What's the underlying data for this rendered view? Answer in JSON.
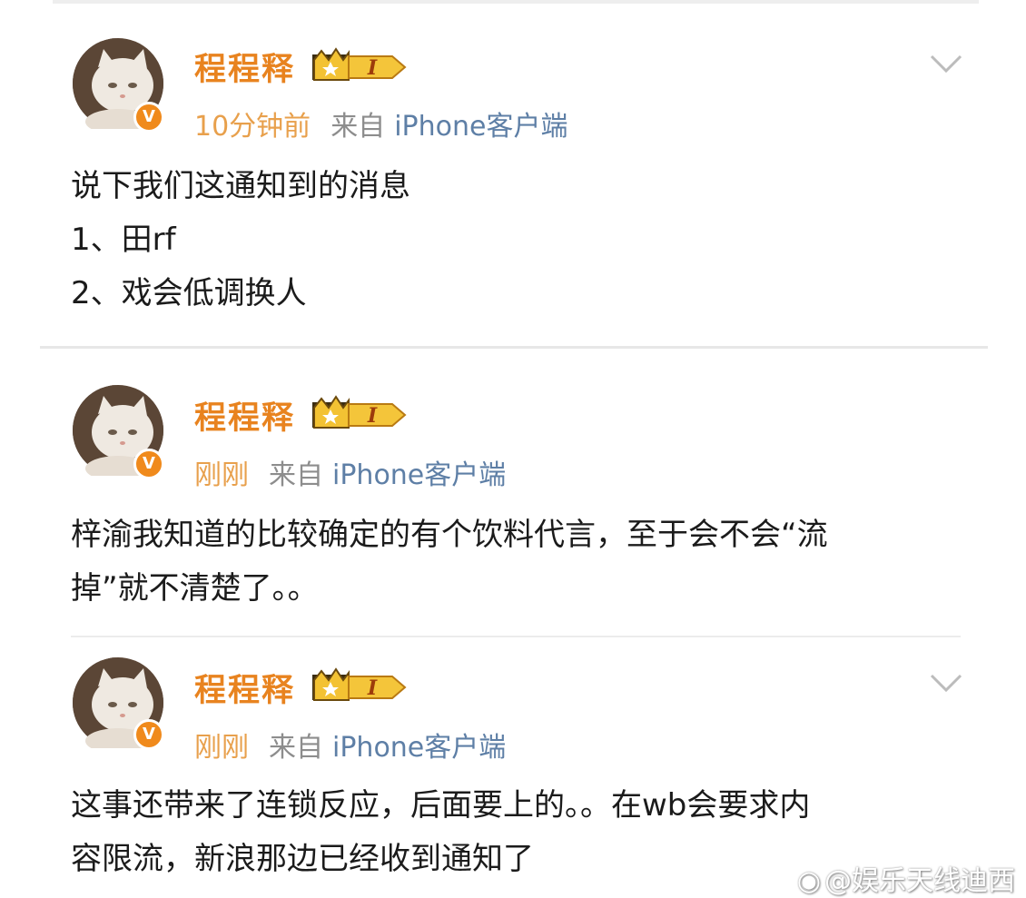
{
  "posts": [
    {
      "username": "程程释",
      "badge_level": "I",
      "time": "10分钟前",
      "source_prefix": "来自",
      "source_client": "iPhone客户端",
      "lines": [
        "说下我们这通知到的消息",
        "1、田rf",
        "2、戏会低调换人"
      ]
    },
    {
      "username": "程程释",
      "badge_level": "I",
      "time": "刚刚",
      "source_prefix": "来自",
      "source_client": "iPhone客户端",
      "lines": [
        "梓渝我知道的比较确定的有个饮料代言，至于会不会“流",
        "掉”就不清楚了。。"
      ]
    },
    {
      "username": "程程释",
      "badge_level": "I",
      "time": "刚刚",
      "source_prefix": "来自",
      "source_client": "iPhone客户端",
      "lines": [
        "这事还带来了连锁反应，后面要上的。。在wb会要求内",
        "容限流，新浪那边已经收到通知了"
      ]
    }
  ],
  "watermark": {
    "text": "@娱乐天线迪西"
  },
  "icons": {
    "avatar": "cat-avatar-icon",
    "verified": "verified-v-icon",
    "badge": "crown-level-badge-icon",
    "menu": "chevron-down-icon",
    "watermark": "weibo-logo-icon"
  },
  "colors": {
    "username": "#e8831f",
    "time": "#e8a04c",
    "source": "#8d8d8d",
    "client": "#5e7fa6",
    "verified": "#f08a1c"
  }
}
